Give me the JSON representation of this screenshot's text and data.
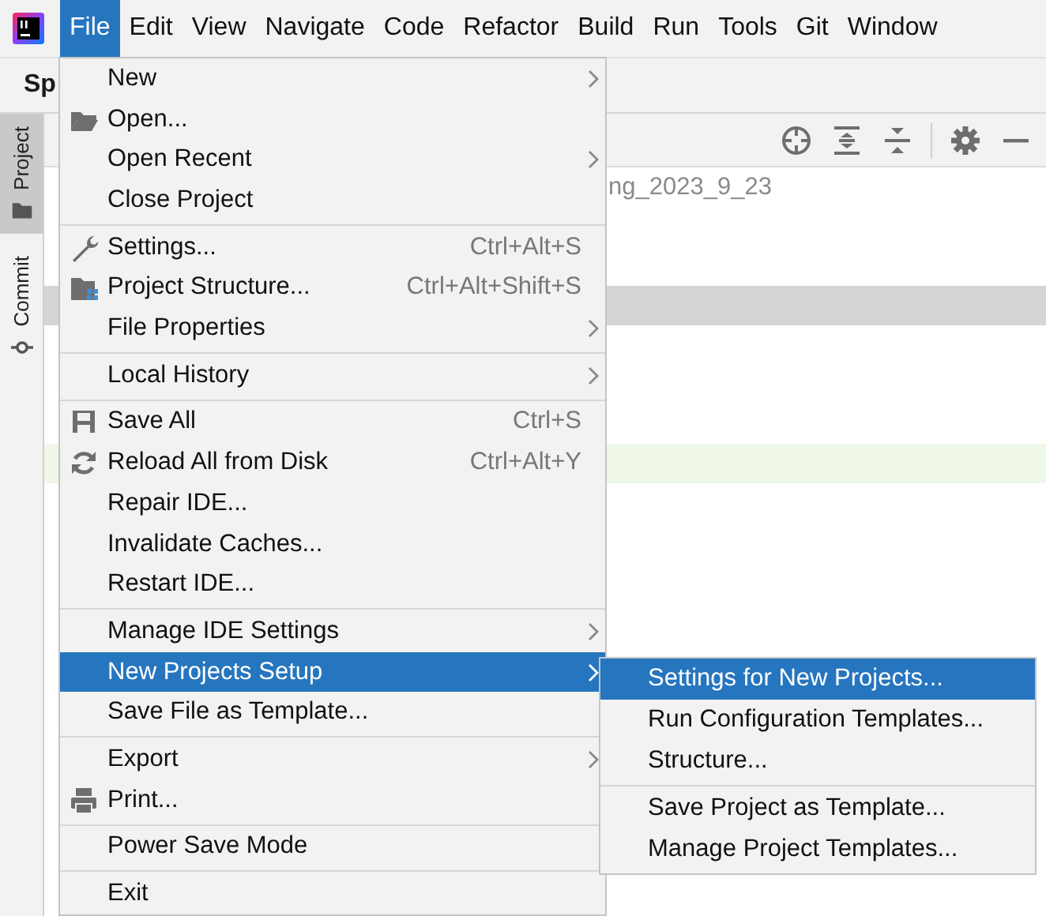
{
  "menu_bar": [
    {
      "label": "File",
      "selected": true
    },
    {
      "label": "Edit",
      "selected": false
    },
    {
      "label": "View",
      "selected": false
    },
    {
      "label": "Navigate",
      "selected": false
    },
    {
      "label": "Code",
      "selected": false
    },
    {
      "label": "Refactor",
      "selected": false
    },
    {
      "label": "Build",
      "selected": false
    },
    {
      "label": "Run",
      "selected": false
    },
    {
      "label": "Tools",
      "selected": false
    },
    {
      "label": "Git",
      "selected": false
    },
    {
      "label": "Window",
      "selected": false
    }
  ],
  "toolbar": {
    "title": "Sp"
  },
  "tool_strip": [
    {
      "label": "Project",
      "selected": true
    },
    {
      "label": "Commit",
      "selected": false
    }
  ],
  "project_tree": [
    {
      "kind": "file",
      "text": "ng_2023_9_23"
    },
    {
      "kind": "blank"
    },
    {
      "kind": "blank"
    },
    {
      "kind": "selected"
    },
    {
      "kind": "blank"
    },
    {
      "kind": "blank"
    },
    {
      "kind": "blank"
    },
    {
      "kind": "modified"
    }
  ],
  "file_menu": [
    [
      {
        "label": "New",
        "kind": "plain",
        "has_submenu": true,
        "selected": false
      },
      {
        "label": "Open...",
        "kind": "folder",
        "has_submenu": false,
        "selected": false
      },
      {
        "label": "Open Recent",
        "kind": "plain",
        "has_submenu": true,
        "selected": false
      },
      {
        "label": "Close Project",
        "kind": "plain",
        "has_submenu": false,
        "selected": false
      }
    ],
    [
      {
        "label": "Settings...",
        "kind": "wrench",
        "shortcut": "Ctrl+Alt+S",
        "has_submenu": false,
        "selected": false
      },
      {
        "label": "Project Structure...",
        "kind": "structure",
        "shortcut": "Ctrl+Alt+Shift+S",
        "has_submenu": false,
        "selected": false
      },
      {
        "label": "File Properties",
        "kind": "plain",
        "has_submenu": true,
        "selected": false
      }
    ],
    [
      {
        "label": "Local History",
        "kind": "plain",
        "has_submenu": true,
        "selected": false
      }
    ],
    [
      {
        "label": "Save All",
        "kind": "save",
        "shortcut": "Ctrl+S",
        "has_submenu": false,
        "selected": false
      },
      {
        "label": "Reload All from Disk",
        "kind": "reload",
        "shortcut": "Ctrl+Alt+Y",
        "has_submenu": false,
        "selected": false
      },
      {
        "label": "Repair IDE...",
        "kind": "plain",
        "has_submenu": false,
        "selected": false
      },
      {
        "label": "Invalidate Caches...",
        "kind": "plain",
        "has_submenu": false,
        "selected": false
      },
      {
        "label": "Restart IDE...",
        "kind": "plain",
        "has_submenu": false,
        "selected": false
      }
    ],
    [
      {
        "label": "Manage IDE Settings",
        "kind": "plain",
        "has_submenu": true,
        "selected": false
      },
      {
        "label": "New Projects Setup",
        "kind": "plain",
        "has_submenu": true,
        "selected": true
      },
      {
        "label": "Save File as Template...",
        "kind": "plain",
        "has_submenu": false,
        "selected": false
      }
    ],
    [
      {
        "label": "Export",
        "kind": "plain",
        "has_submenu": true,
        "selected": false
      },
      {
        "label": "Print...",
        "kind": "print",
        "has_submenu": false,
        "selected": false
      }
    ],
    [
      {
        "label": "Power Save Mode",
        "kind": "plain",
        "has_submenu": false,
        "selected": false
      }
    ],
    [
      {
        "label": "Exit",
        "kind": "plain",
        "has_submenu": false,
        "selected": false
      }
    ]
  ],
  "submenu": [
    [
      {
        "label": "Settings for New Projects...",
        "selected": true
      },
      {
        "label": "Run Configuration Templates...",
        "selected": false
      },
      {
        "label": "Structure...",
        "selected": false
      }
    ],
    [
      {
        "label": "Save Project as Template...",
        "selected": false
      },
      {
        "label": "Manage Project Templates...",
        "selected": false
      }
    ]
  ]
}
